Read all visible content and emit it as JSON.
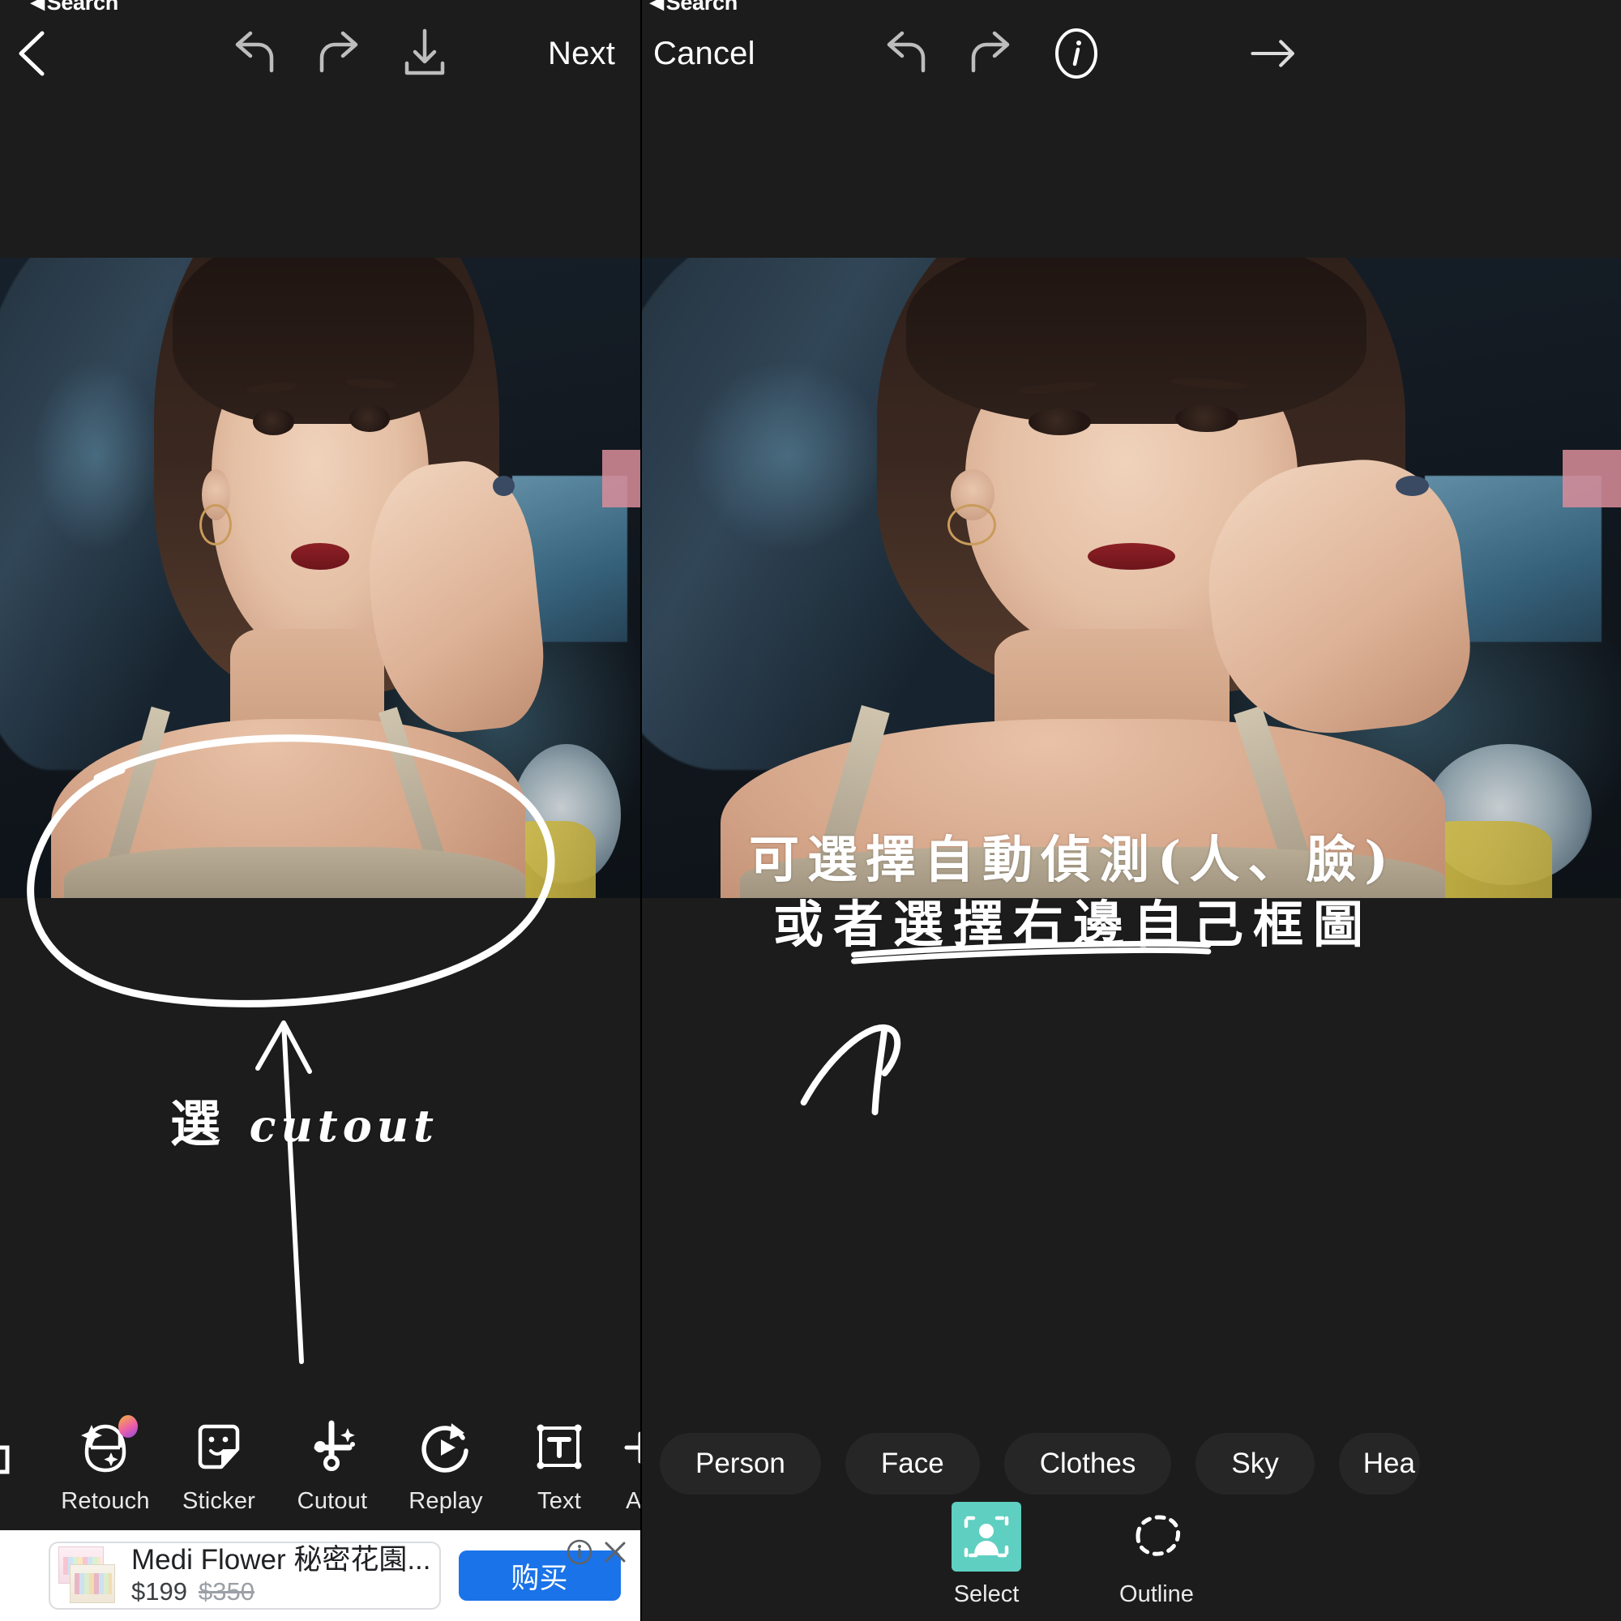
{
  "status": {
    "back_label": "Search",
    "caret": "◀"
  },
  "left_panel": {
    "nav": {
      "back_icon": "chevron-left-icon",
      "undo_icon": "undo-icon",
      "redo_icon": "redo-icon",
      "download_icon": "download-icon",
      "next_label": "Next"
    },
    "annotation": {
      "text": "選 cutout",
      "cn": "選",
      "en": "cutout"
    },
    "toolbar": [
      {
        "label": "Retouch",
        "icon": "retouch-face-icon",
        "badge": true
      },
      {
        "label": "Sticker",
        "icon": "sticker-icon",
        "badge": false
      },
      {
        "label": "Cutout",
        "icon": "cutout-scissors-icon",
        "badge": false
      },
      {
        "label": "Replay",
        "icon": "replay-icon",
        "badge": false
      },
      {
        "label": "Text",
        "icon": "text-box-icon",
        "badge": false
      },
      {
        "label": "Ad",
        "icon": "add-icon",
        "badge": false
      }
    ],
    "ad": {
      "title": "Medi Flower 秘密花園...",
      "price": "$199",
      "old_price": "$350",
      "cta_label": "购买",
      "info_icon": "ad-info-icon",
      "close_icon": "close-icon"
    }
  },
  "right_panel": {
    "nav": {
      "cancel_label": "Cancel",
      "undo_icon": "undo-icon",
      "redo_icon": "redo-icon",
      "info_icon": "info-circle-icon",
      "forward_icon": "arrow-right-icon"
    },
    "annotation": {
      "line1": "可選擇自動偵測(人、臉)",
      "line2": "或者選擇右邊自己框圖"
    },
    "chips": [
      {
        "label": "Person"
      },
      {
        "label": "Face"
      },
      {
        "label": "Clothes"
      },
      {
        "label": "Sky"
      },
      {
        "label": "Hea"
      }
    ],
    "modes": [
      {
        "label": "Select",
        "icon": "person-in-frame-icon",
        "selected": true
      },
      {
        "label": "Outline",
        "icon": "dashed-lasso-icon",
        "selected": false
      }
    ]
  },
  "colors": {
    "accent_teal": "#5ecfc0",
    "chip_bg": "#262626",
    "panel_bg": "#1c1c1c",
    "ad_cta_blue": "#1a73e8",
    "ink_white": "#ffffff"
  }
}
